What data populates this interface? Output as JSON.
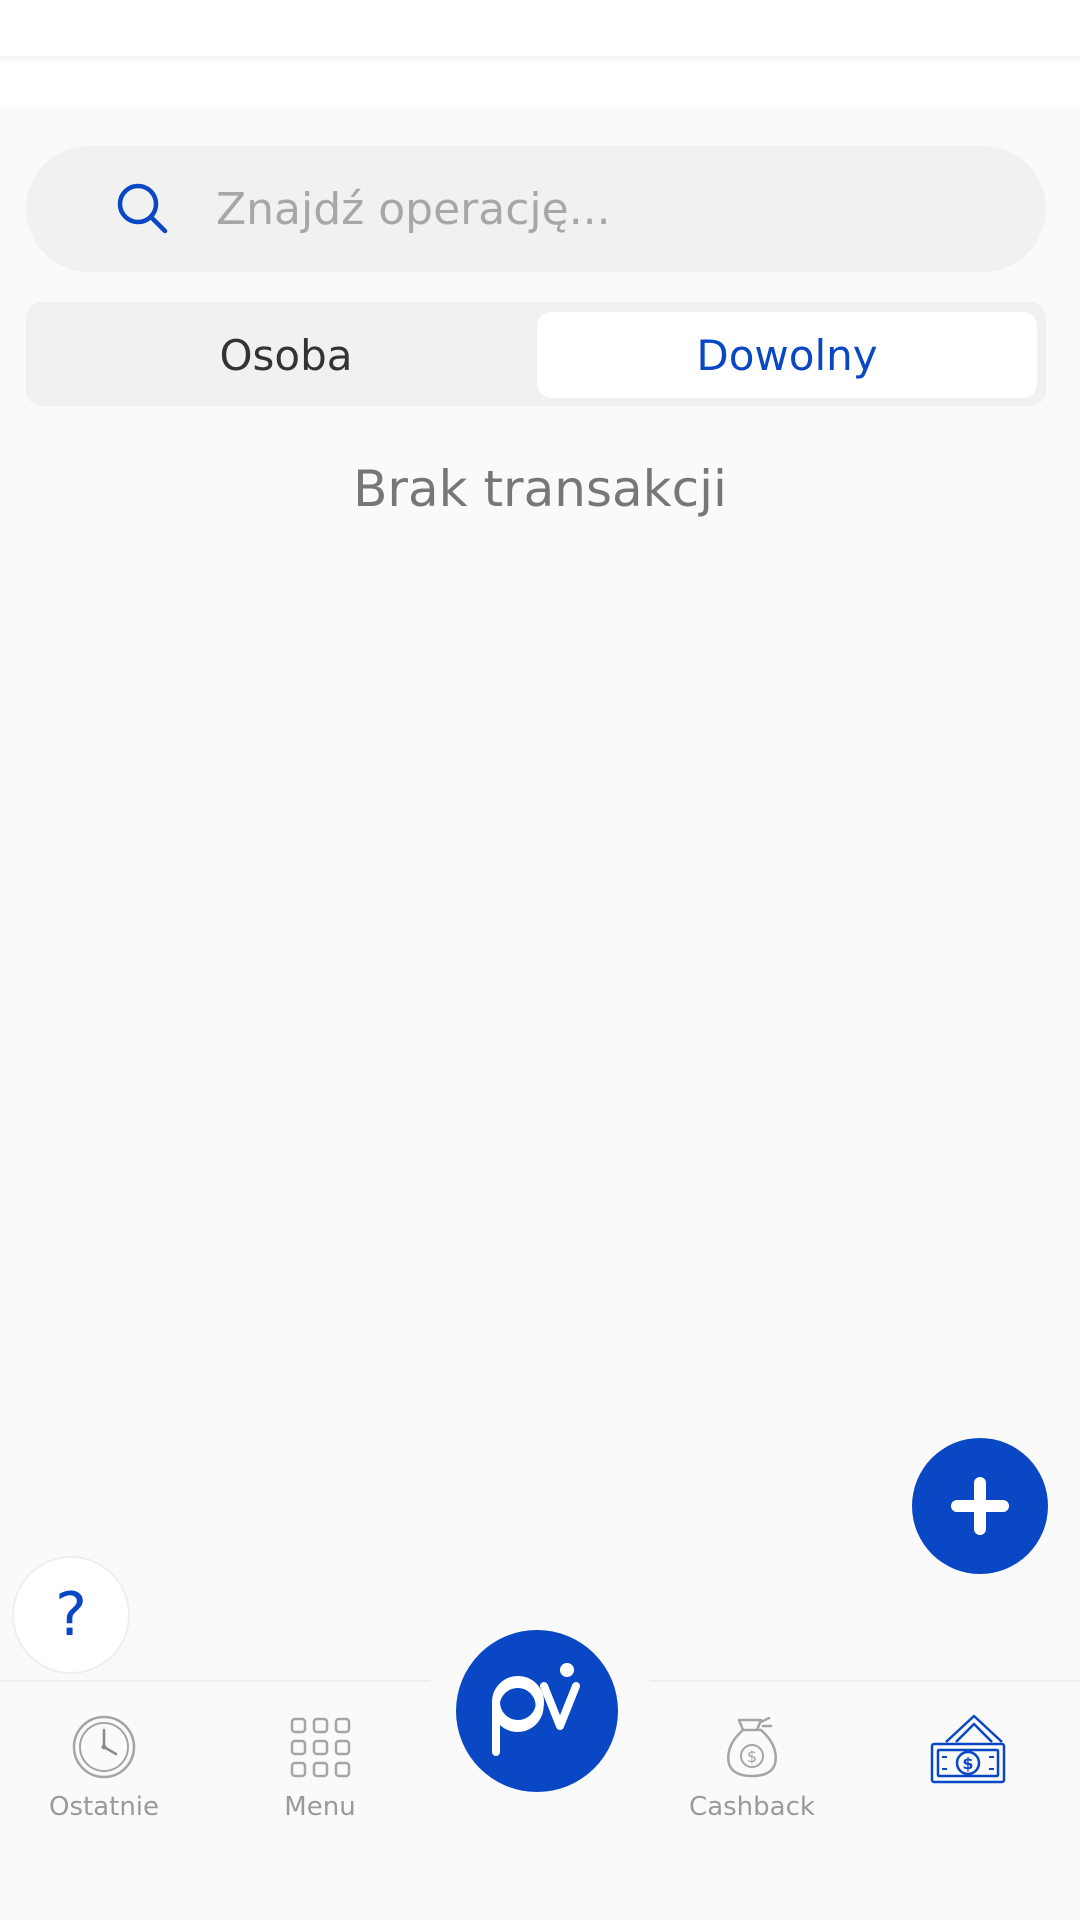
{
  "search": {
    "placeholder": "Znajdź operację..."
  },
  "segment": {
    "left_label": "Osoba",
    "right_label": "Dowolny",
    "selected": "Dowolny"
  },
  "main": {
    "empty_text": "Brak transakcji"
  },
  "help": {
    "label": "?"
  },
  "bottom_nav": {
    "items": [
      {
        "label": "Ostatnie",
        "icon": "clock-icon"
      },
      {
        "label": "Menu",
        "icon": "grid-icon"
      },
      {
        "label": "",
        "icon": "pv-logo-icon"
      },
      {
        "label": "Cashback",
        "icon": "money-bag-icon"
      },
      {
        "label": "",
        "icon": "cash-bills-icon"
      }
    ]
  },
  "colors": {
    "accent": "#0a47c4",
    "background": "#fafafa",
    "search_bg": "#f1f1f1",
    "muted_text": "#9a9a9a"
  }
}
